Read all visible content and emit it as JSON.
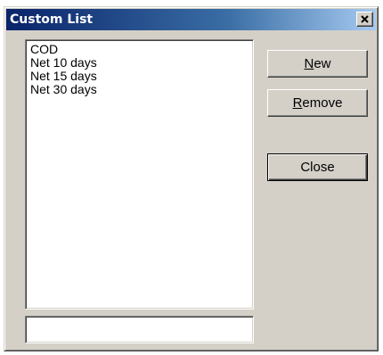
{
  "window": {
    "title": "Custom List",
    "close_glyph": "×"
  },
  "list": {
    "items": [
      "COD",
      "Net 10 days",
      "Net 15 days",
      "Net 30 days"
    ]
  },
  "textbox": {
    "value": ""
  },
  "buttons": {
    "new": {
      "mnemonic": "N",
      "rest": "ew"
    },
    "remove": {
      "mnemonic": "R",
      "rest": "emove"
    },
    "close": {
      "label": "Close"
    }
  },
  "colors": {
    "face": "#d4d0c8",
    "title_start": "#0a246a",
    "title_end": "#a6caf0"
  }
}
